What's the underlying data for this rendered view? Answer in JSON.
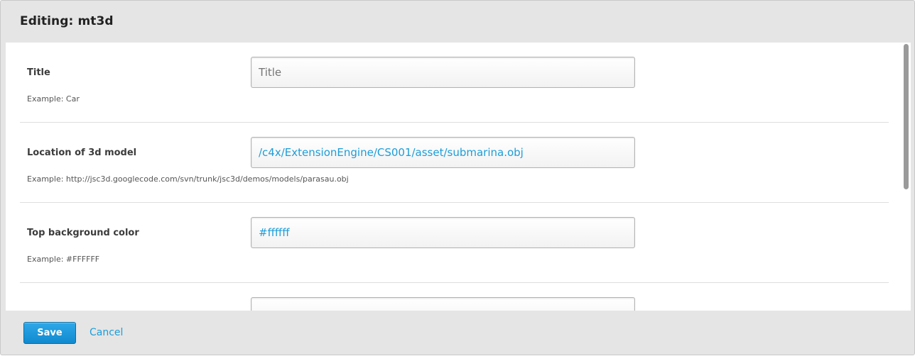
{
  "header": {
    "title": "Editing: mt3d"
  },
  "settings": [
    {
      "label": "Title",
      "value": "",
      "placeholder": "Title",
      "help": "Example: Car"
    },
    {
      "label": "Location of 3d model",
      "value": "/c4x/ExtensionEngine/CS001/asset/submarina.obj",
      "placeholder": "",
      "help": "Example: http://jsc3d.googlecode.com/svn/trunk/jsc3d/demos/models/parasau.obj"
    },
    {
      "label": "Top background color",
      "value": "#ffffff",
      "placeholder": "",
      "help": "Example: #FFFFFF"
    },
    {
      "label": "",
      "value": "",
      "placeholder": "",
      "help": ""
    }
  ],
  "footer": {
    "save_label": "Save",
    "cancel_label": "Cancel"
  },
  "colors": {
    "accent": "#1d9dd9",
    "primary_button": "#1189cf",
    "modal_bg": "#e5e5e5"
  }
}
